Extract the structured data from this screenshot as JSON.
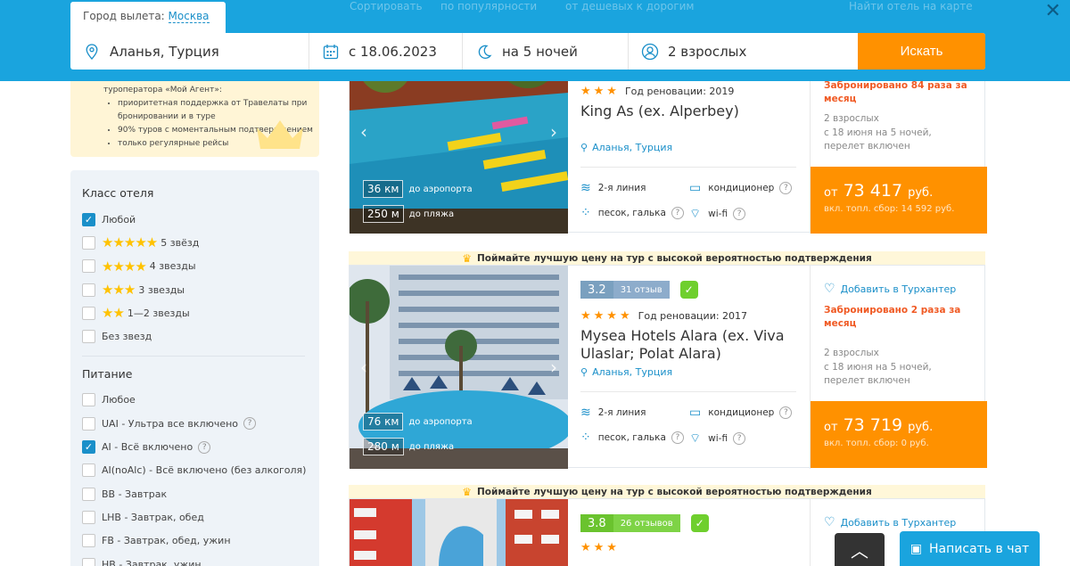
{
  "topbar": {
    "ghost_sort": "Сортировать",
    "ghost_popular": "по популярности",
    "ghost_cheap": "от дешевых к дорогим",
    "ghost_map": "Найти отель на карте",
    "city_label": "Город вылета:",
    "city_value": "Москва",
    "destination": "Аланья, Турция",
    "date": "с 18.06.2023",
    "nights": "на 5 ночей",
    "pax": "2 взрослых",
    "search_label": "Искать"
  },
  "promo": {
    "intro": "туроператора «Мой Агент»:",
    "items": [
      "приоритетная поддержка от Травелаты при бронировании и в туре",
      "90% туров с моментальным подтверждением",
      "только регулярные рейсы"
    ]
  },
  "filters": {
    "class_title": "Класс отеля",
    "class_options": [
      "Любой",
      "5 звёзд",
      "4 звезды",
      "3 звезды",
      "1—2 звезды",
      "Без звезд"
    ],
    "food_title": "Питание",
    "food_options": [
      "Любое",
      "UAI - Ультра все включено",
      "AI - Всё включено",
      "AI(noAlc) - Всё включено (без алкоголя)",
      "BB - Завтрак",
      "LHB - Завтрак, обед",
      "FB - Завтрак, обед, ужин",
      "HB - Завтрак, ужин"
    ]
  },
  "banner_text": "Поймайте лучшую цену на тур с высокой вероятностью подтверждения",
  "hotels": [
    {
      "renovation": "Год реновации: 2019",
      "name": "King As (ex. Alperbey)",
      "location": "Аланья, Турция",
      "dist_airport": "36 км",
      "dist_airport_label": "до аэропорта",
      "dist_beach": "250 м",
      "dist_beach_label": "до пляжа",
      "line": "2-я линия",
      "beach_type": "песок, галька",
      "ac": "кондиционер",
      "wifi": "wi-fi",
      "booked": "Забронировано 84 раза за месяц",
      "pax_line1": "2 взрослых",
      "pax_line2": "с 18 июня на 5 ночей,",
      "pax_line3": "перелет включен",
      "price_prefix": "от",
      "price": "73 417",
      "currency": "руб.",
      "fee": "вкл. топл. сбор: 14 592 руб."
    },
    {
      "score": "3.2",
      "reviews": "31 отзыв",
      "renovation": "Год реновации: 2017",
      "name": "Mysea Hotels Alara (ex. Viva Ulaslar; Polat Alara)",
      "location": "Аланья, Турция",
      "dist_airport": "76 км",
      "dist_airport_label": "до аэропорта",
      "dist_beach": "280 м",
      "dist_beach_label": "до пляжа",
      "line": "2-я линия",
      "beach_type": "песок, галька",
      "ac": "кондиционер",
      "wifi": "wi-fi",
      "hunter": "Добавить в Турхантер",
      "booked": "Забронировано 2 раза за месяц",
      "pax_line1": "2 взрослых",
      "pax_line2": "с 18 июня на 5 ночей,",
      "pax_line3": "перелет включен",
      "price_prefix": "от",
      "price": "73 719",
      "currency": "руб.",
      "fee": "вкл. топл. сбор: 0 руб."
    },
    {
      "score": "3.8",
      "reviews": "26 отзывов",
      "hunter": "Добавить в Турхантер"
    }
  ],
  "chat_label": "Написать в чат",
  "colors": {
    "brand_blue": "#1aa4de",
    "orange": "#ff9100",
    "booked_red": "#f05a24"
  }
}
